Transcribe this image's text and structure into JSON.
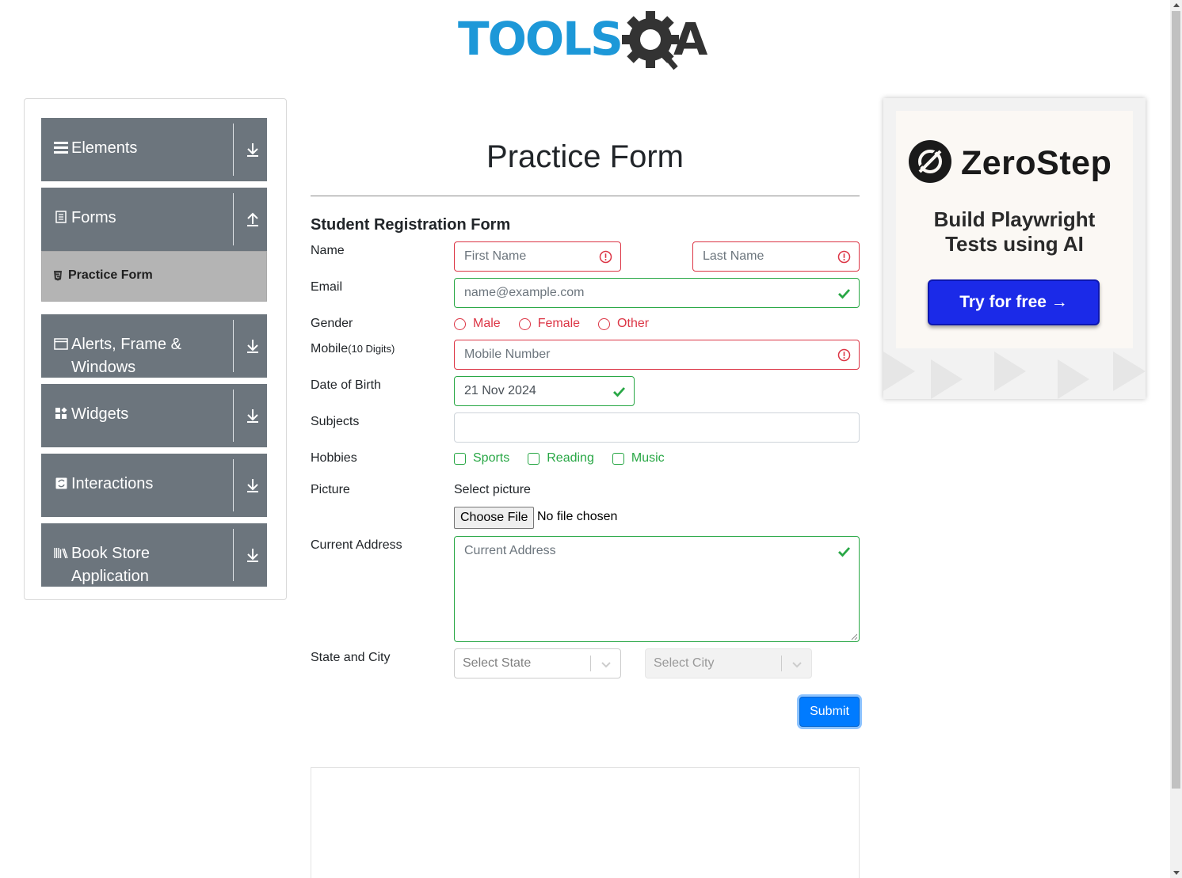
{
  "brand": {
    "logo_text": "TOOLSQA",
    "logo_colors": {
      "tools": "#1d98d8",
      "qa": "#333333"
    }
  },
  "sidebar": {
    "groups": [
      {
        "label": "Elements",
        "icon": "hamburger-icon",
        "arrow": "download-arrow-icon"
      },
      {
        "label": "Forms",
        "icon": "document-icon",
        "arrow": "upload-arrow-icon"
      },
      {
        "label": "Alerts, Frame & Windows",
        "icon": "window-icon",
        "arrow": "download-arrow-icon"
      },
      {
        "label": "Widgets",
        "icon": "widgets-icon",
        "arrow": "download-arrow-icon"
      },
      {
        "label": "Interactions",
        "icon": "interactions-icon",
        "arrow": "download-arrow-icon"
      },
      {
        "label": "Book Store Application",
        "icon": "books-icon",
        "arrow": "download-arrow-icon"
      }
    ],
    "active_item": {
      "label": "Practice Form",
      "icon": "html5-icon"
    }
  },
  "page": {
    "title": "Practice Form",
    "form_title": "Student Registration Form"
  },
  "form": {
    "name_label": "Name",
    "first_name_placeholder": "First Name",
    "last_name_placeholder": "Last Name",
    "email_label": "Email",
    "email_placeholder": "name@example.com",
    "gender_label": "Gender",
    "gender_options": [
      "Male",
      "Female",
      "Other"
    ],
    "mobile_label": "Mobile",
    "mobile_hint": "(10 Digits)",
    "mobile_placeholder": "Mobile Number",
    "dob_label": "Date of Birth",
    "dob_value": "21 Nov 2024",
    "subjects_label": "Subjects",
    "hobbies_label": "Hobbies",
    "hobbies_options": [
      "Sports",
      "Reading",
      "Music"
    ],
    "picture_label": "Picture",
    "picture_select_text": "Select picture",
    "choose_file_button": "Choose File",
    "no_file_text": "No file chosen",
    "address_label": "Current Address",
    "address_placeholder": "Current Address",
    "state_city_label": "State and City",
    "state_placeholder": "Select State",
    "city_placeholder": "Select City",
    "submit_label": "Submit",
    "colors": {
      "error": "#dc3545",
      "valid": "#28a745",
      "primary": "#007bff"
    }
  },
  "ad": {
    "brand": "ZeroStep",
    "headline_line1": "Build Playwright",
    "headline_line2": "Tests using AI",
    "cta": "Try for free →",
    "cta_color": "#1b2ae8"
  }
}
